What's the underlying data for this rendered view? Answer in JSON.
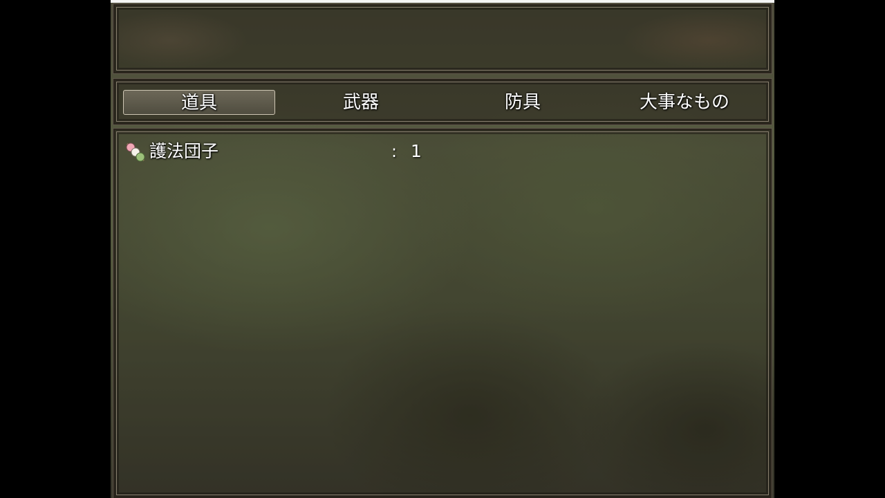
{
  "screen": {
    "type": "item-menu"
  },
  "help_window": {
    "text": ""
  },
  "categories": [
    {
      "label": "道具",
      "selected": true
    },
    {
      "label": "武器",
      "selected": false
    },
    {
      "label": "防具",
      "selected": false
    },
    {
      "label": "大事なもの",
      "selected": false
    }
  ],
  "items": [
    {
      "name": "護法団子",
      "separator": ":",
      "count": "1",
      "icon": "dango-icon"
    }
  ],
  "colors": {
    "text": "#ffffff",
    "window_border": "#8a8170",
    "selection": "#cfc7b4"
  }
}
